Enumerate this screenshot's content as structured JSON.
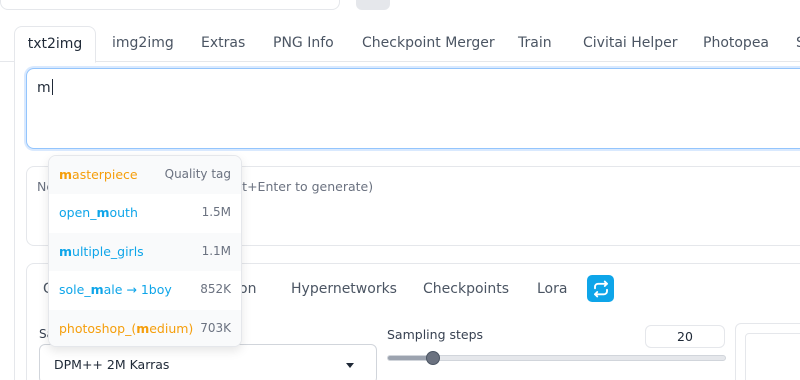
{
  "tabs": [
    {
      "label": "txt2img",
      "active": true
    },
    {
      "label": "img2img"
    },
    {
      "label": "Extras"
    },
    {
      "label": "PNG Info"
    },
    {
      "label": "Checkpoint Merger"
    },
    {
      "label": "Train"
    },
    {
      "label": "Civitai Helper"
    },
    {
      "label": "Photopea"
    },
    {
      "label": "S"
    }
  ],
  "prompt": {
    "value": "m"
  },
  "negative_prompt": {
    "placeholder_visible": "Ne",
    "placeholder_tail": "r Alt+Enter to generate)"
  },
  "autocomplete": {
    "items": [
      {
        "pre": "",
        "match": "m",
        "post": "asterpiece",
        "meta": "Quality tag",
        "color": "#f59e0b"
      },
      {
        "pre": "open_",
        "match": "m",
        "post": "outh",
        "meta": "1.5M",
        "color": "#0ea5e9"
      },
      {
        "pre": "",
        "match": "m",
        "post": "ultiple_girls",
        "meta": "1.1M",
        "color": "#0ea5e9"
      },
      {
        "pre": "sole_",
        "match": "m",
        "post": "ale → 1boy",
        "meta": "852K",
        "color": "#0ea5e9"
      },
      {
        "pre": "photoshop_(",
        "match": "m",
        "post": "edium)",
        "meta": "703K",
        "color": "#f59e0b"
      }
    ]
  },
  "extra_networks": {
    "tabs": [
      {
        "label": "G"
      },
      {
        "label": "on"
      },
      {
        "label": "Hypernetworks"
      },
      {
        "label": "Checkpoints"
      },
      {
        "label": "Lora"
      }
    ],
    "refresh_icon": "refresh-icon",
    "accent": "#0ea5e9"
  },
  "sampler": {
    "label": "Sa",
    "value": "DPM++ 2M Karras"
  },
  "steps": {
    "label": "Sampling steps",
    "value": "20",
    "fraction": 0.12
  }
}
